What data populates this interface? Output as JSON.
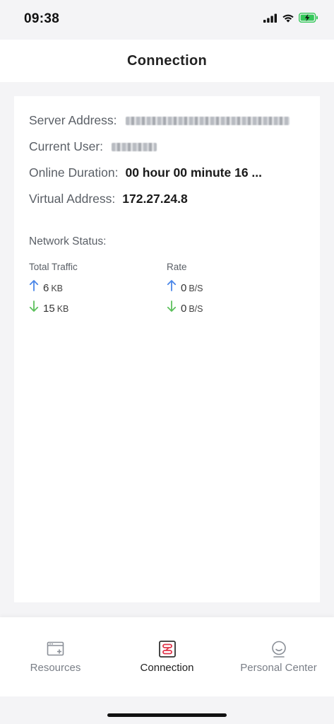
{
  "status_bar": {
    "time": "09:38"
  },
  "header": {
    "title": "Connection"
  },
  "info": {
    "server_address_label": "Server Address:",
    "current_user_label": "Current User:",
    "online_duration_label": "Online Duration:",
    "online_duration_value": "00 hour 00 minute 16 ...",
    "virtual_address_label": "Virtual Address:",
    "virtual_address_value": "172.27.24.8"
  },
  "network": {
    "title": "Network Status:",
    "total_traffic_label": "Total Traffic",
    "rate_label": "Rate",
    "traffic_up_value": "6",
    "traffic_up_unit": "KB",
    "traffic_down_value": "15",
    "traffic_down_unit": "KB",
    "rate_up_value": "0",
    "rate_up_unit": "B/S",
    "rate_down_value": "0",
    "rate_down_unit": "B/S"
  },
  "colors": {
    "up_arrow": "#4a86e8",
    "down_arrow": "#5cc05c",
    "active_tab_icon": "#e0344a",
    "battery": "#34c759"
  },
  "tabs": [
    {
      "label": "Resources",
      "icon": "browser-plus-icon"
    },
    {
      "label": "Connection",
      "icon": "connection-icon"
    },
    {
      "label": "Personal Center",
      "icon": "smiley-user-icon"
    }
  ]
}
